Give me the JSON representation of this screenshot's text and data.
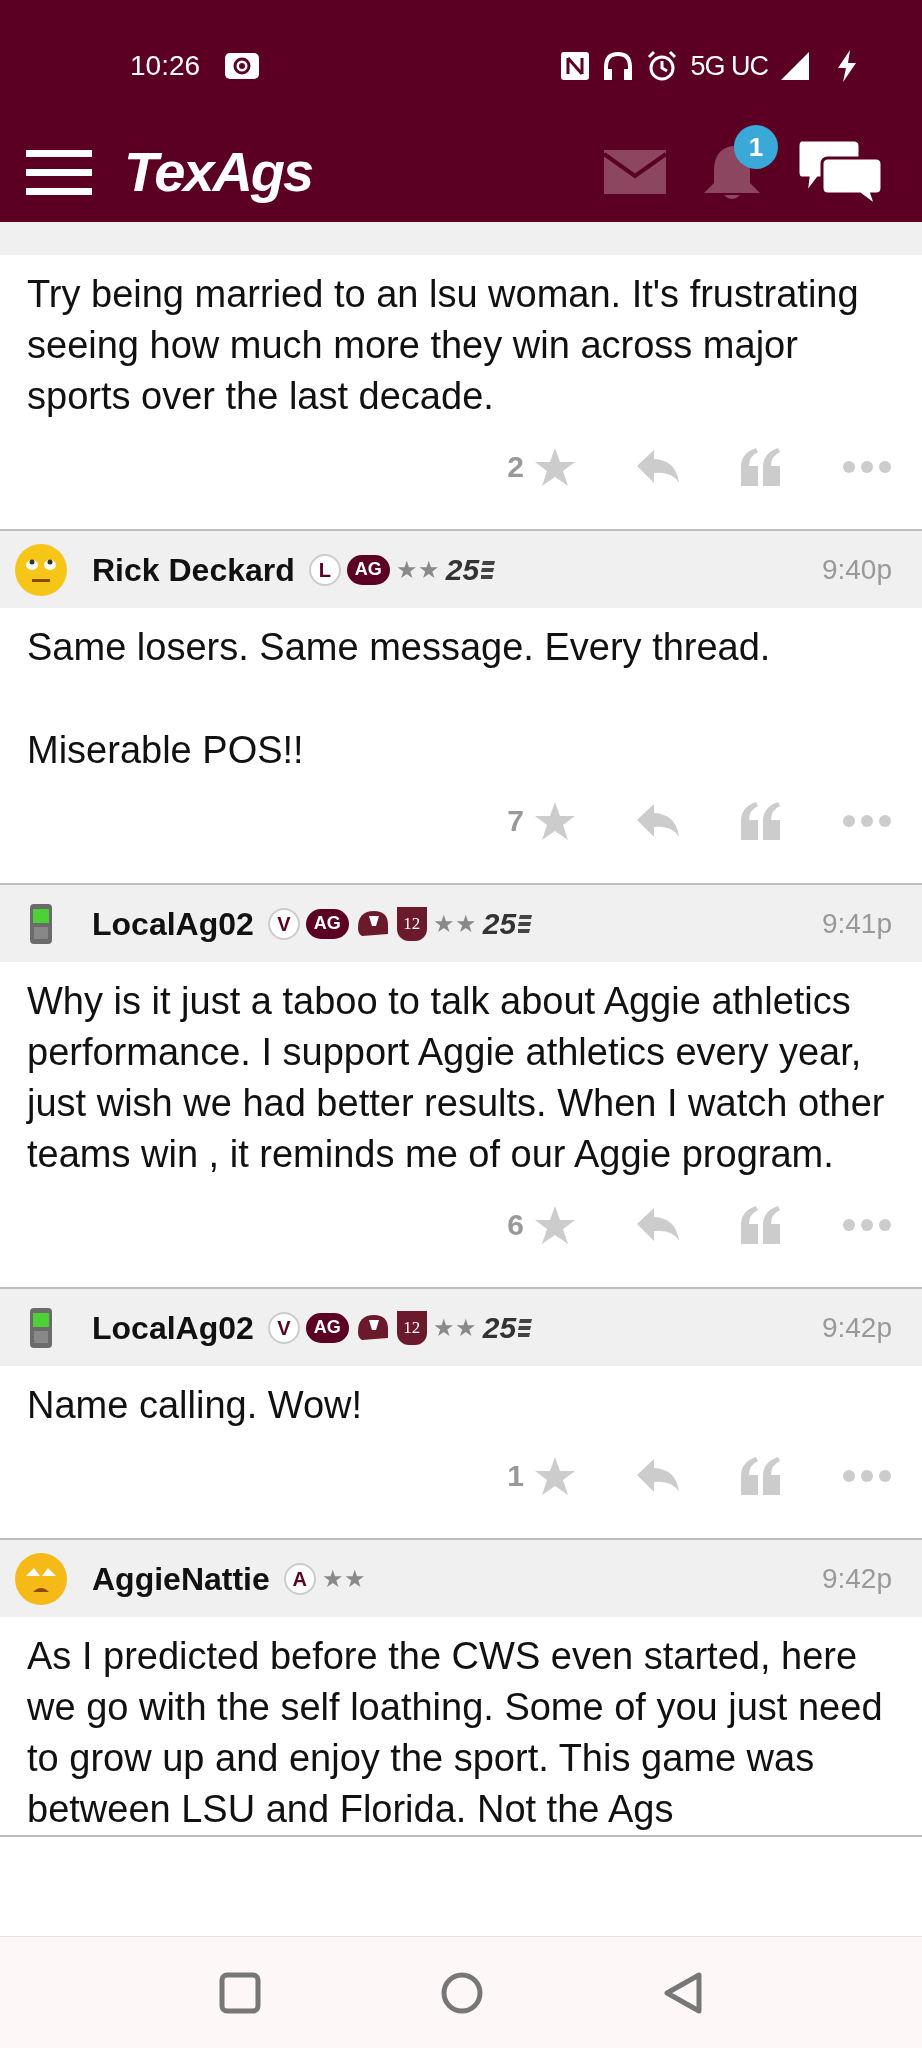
{
  "status_bar": {
    "time": "10:26",
    "network": "5G UC"
  },
  "app_bar": {
    "logo": "TexAgs",
    "notification_count": "1"
  },
  "posts": [
    {
      "paragraphs": [
        "Try being married to an lsu woman. It's frustrating seeing how much more they win across major sports over the last decade."
      ],
      "star_count": "2"
    },
    {
      "avatar": {
        "kind": "rolling-eyes"
      },
      "author": "Rick Deckard",
      "badges": [
        {
          "kind": "circle",
          "text": "L"
        },
        {
          "kind": "pill",
          "text": "AG"
        },
        {
          "kind": "stars",
          "text": "★★"
        },
        {
          "kind": "years",
          "text": "25"
        }
      ],
      "time": "9:40p",
      "paragraphs": [
        "Same losers. Same message. Every thread.",
        "Miserable POS!!"
      ],
      "star_count": "7"
    },
    {
      "avatar": {
        "kind": "phone"
      },
      "author": "LocalAg02",
      "badges": [
        {
          "kind": "circle",
          "text": "V"
        },
        {
          "kind": "pill",
          "text": "AG"
        },
        {
          "kind": "helmet"
        },
        {
          "kind": "shield",
          "text": "12"
        },
        {
          "kind": "stars",
          "text": "★★"
        },
        {
          "kind": "years",
          "text": "25"
        }
      ],
      "time": "9:41p",
      "paragraphs": [
        "Why is it just a taboo to talk about Aggie athletics performance. I support Aggie athletics every year, just wish we had better results. When I watch other teams win , it reminds me of our Aggie program."
      ],
      "star_count": "6"
    },
    {
      "avatar": {
        "kind": "phone"
      },
      "author": "LocalAg02",
      "badges": [
        {
          "kind": "circle",
          "text": "V"
        },
        {
          "kind": "pill",
          "text": "AG"
        },
        {
          "kind": "helmet"
        },
        {
          "kind": "shield",
          "text": "12"
        },
        {
          "kind": "stars",
          "text": "★★"
        },
        {
          "kind": "years",
          "text": "25"
        }
      ],
      "time": "9:42p",
      "paragraphs": [
        "Name calling. Wow!"
      ],
      "star_count": "1"
    },
    {
      "avatar": {
        "kind": "worried"
      },
      "author": "AggieNattie",
      "badges": [
        {
          "kind": "circle",
          "text": "A"
        },
        {
          "kind": "stars",
          "text": "★★"
        }
      ],
      "time": "9:42p",
      "paragraphs": [
        "As I predicted before the CWS even started, here we go with the self loathing. Some of you just need to grow up and enjoy the sport. This game was between LSU and Florida. Not the Ags"
      ]
    }
  ]
}
